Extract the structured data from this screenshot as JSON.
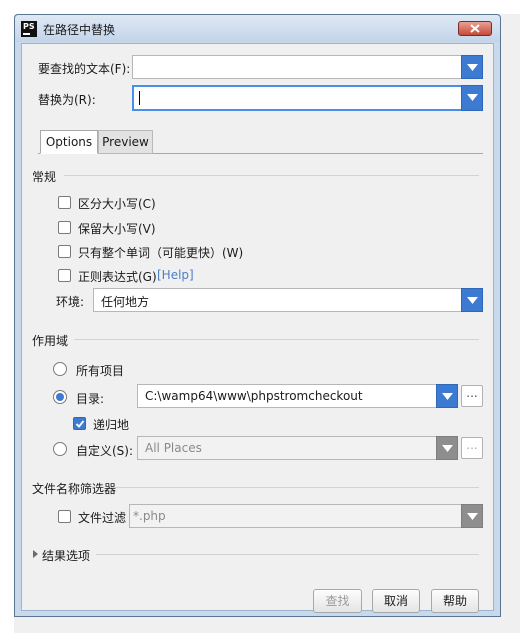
{
  "window": {
    "title": "在路径中替换",
    "logo_text": "PS",
    "close_icon": "close-icon"
  },
  "find": {
    "label": "要查找的文本(F):",
    "value": ""
  },
  "replace": {
    "label": "替换为(R):",
    "value": ""
  },
  "tabs": [
    {
      "label": "Options",
      "active": true
    },
    {
      "label": "Preview",
      "active": false
    }
  ],
  "general": {
    "header": "常规",
    "options": [
      {
        "label": "区分大小写(C)",
        "checked": false
      },
      {
        "label": "保留大小写(V)",
        "checked": false
      },
      {
        "label": "只有整个单词（可能更快）(W)",
        "checked": false
      },
      {
        "label": "正则表达式(G)",
        "checked": false
      }
    ],
    "help_link": "[Help]",
    "context_label": "环境:",
    "context_value": "任何地方"
  },
  "scope": {
    "header": "作用域",
    "all_projects": "所有项目",
    "directory_label": "目录:",
    "directory_value": "C:\\wamp64\\www\\phpstromcheckout",
    "browse_label": "...",
    "recursive_label": "递归地",
    "recursive_checked": true,
    "custom_label": "自定义(S):",
    "custom_value": "All Places",
    "custom_browse_label": "...",
    "selected": "directory"
  },
  "file_filter": {
    "header": "文件名称筛选器",
    "checkbox_label": "文件过滤",
    "checked": false,
    "mask_value": "*.php"
  },
  "results": {
    "header": "结果选项"
  },
  "buttons": {
    "find": "查找",
    "cancel": "取消",
    "help": "帮助"
  },
  "colors": {
    "accent": "#3d7bd3",
    "focus_border": "#4a8fe8",
    "link": "#4a7fc8"
  }
}
